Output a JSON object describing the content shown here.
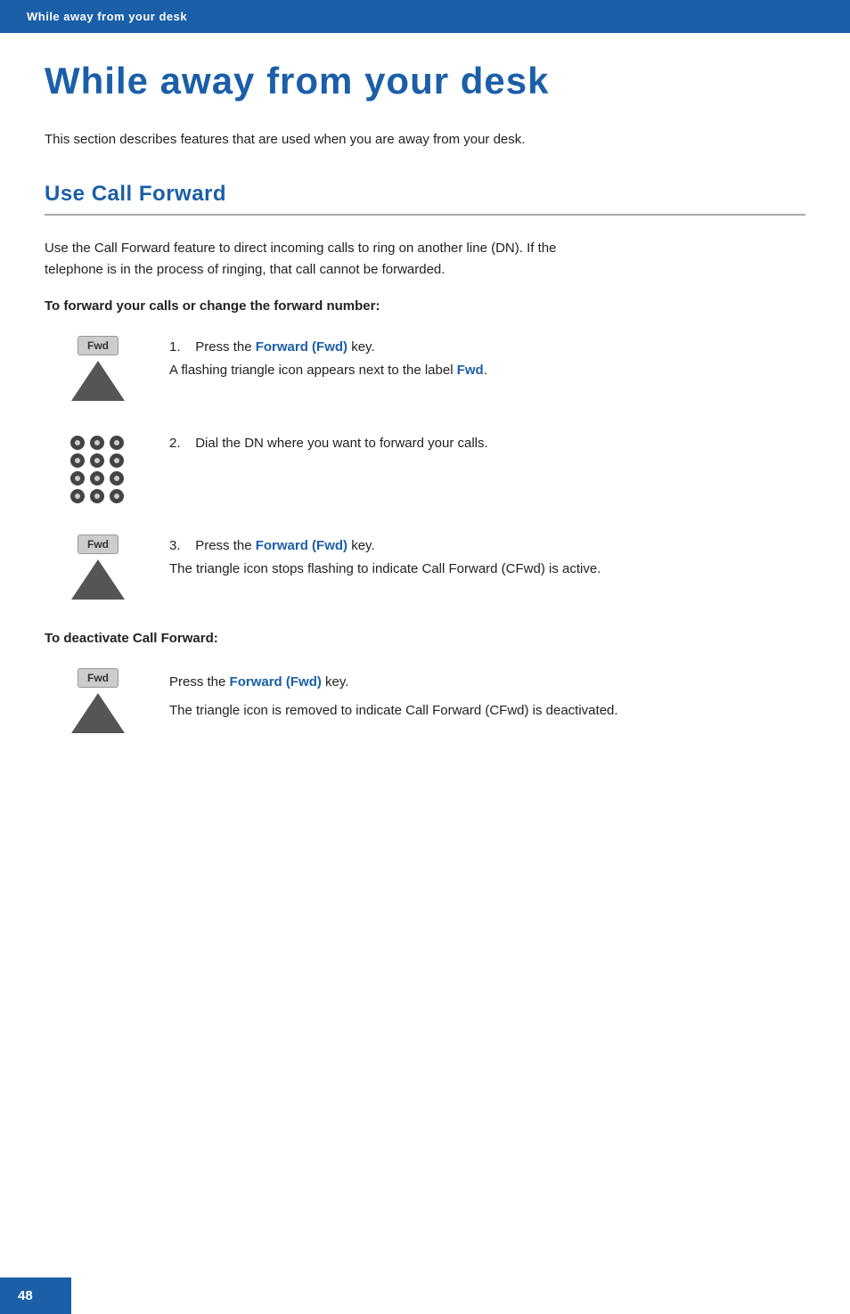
{
  "header": {
    "breadcrumb": "While away from your desk"
  },
  "page": {
    "title": "While away from your desk",
    "intro": "This section describes features that are used when you are away from your desk.",
    "section_title": "Use Call Forward",
    "section_body": "Use the Call Forward feature to direct incoming calls to ring on another line (DN). If the telephone is in the process of ringing, that call cannot be forwarded.",
    "forward_subheading": "To forward your calls or change the forward number:",
    "steps": [
      {
        "number": "1.",
        "text_before": "Press the ",
        "highlight": "Forward (Fwd)",
        "text_after": " key.",
        "note": "A flashing triangle icon appears next to the label ",
        "note_highlight": "Fwd",
        "note_end": "."
      },
      {
        "number": "2.",
        "text": "Dial the DN where you want to forward your calls."
      },
      {
        "number": "3.",
        "text_before": "Press the ",
        "highlight": "Forward (Fwd)",
        "text_after": " key.",
        "note": "The triangle icon stops flashing to indicate Call Forward (CFwd) is active."
      }
    ],
    "deactivate_heading": "To deactivate Call Forward:",
    "deactivate_step": {
      "text_before": "Press the ",
      "highlight": "Forward (Fwd)",
      "text_after": " key.",
      "note": "The triangle icon is removed to indicate Call Forward (CFwd) is deactivated."
    },
    "fwd_label": "Fwd",
    "page_number": "48"
  }
}
